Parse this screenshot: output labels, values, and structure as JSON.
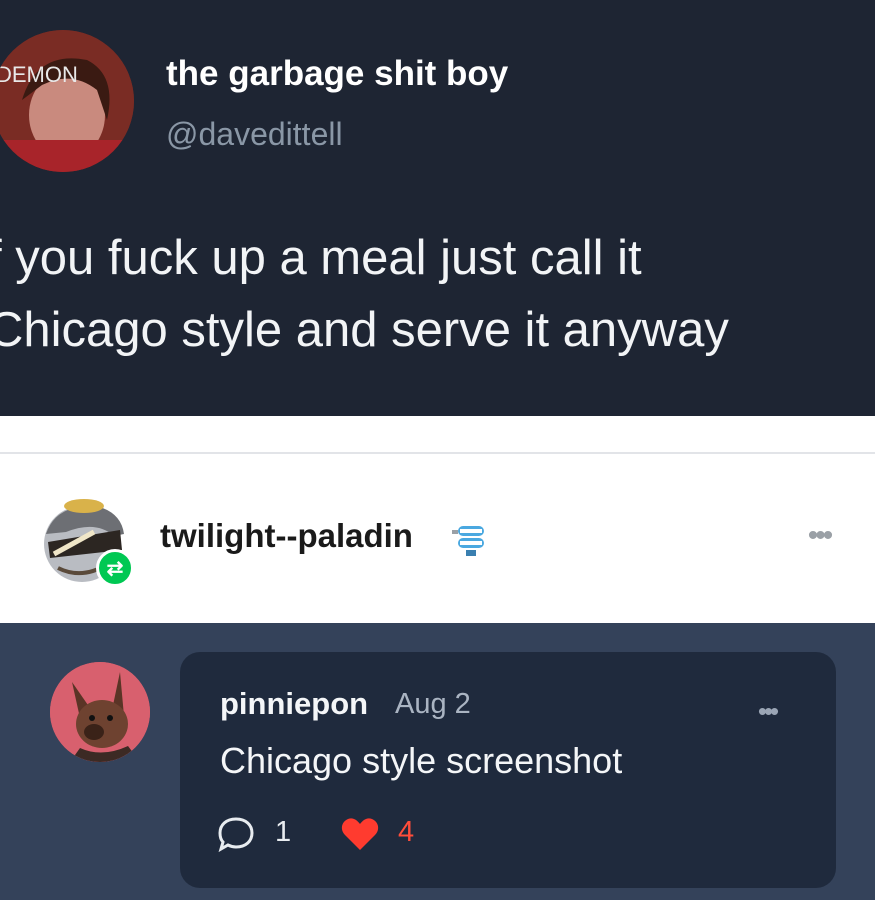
{
  "tweet": {
    "display_name": "the garbage shit boy",
    "handle": "@davedittell",
    "text_lines": [
      "f you fuck up a meal just call it",
      "Chicago style and serve it anyway"
    ],
    "avatar_text": "DEMON",
    "avatar_icon": "profile-photo"
  },
  "post": {
    "blog_name": "twilight--paladin",
    "avatar_icon": "cartoon-avatar",
    "reblog_icon": "reblog-icon",
    "badge_icon": "chattering-teeth-icon",
    "more_label": "•••"
  },
  "note": {
    "username": "pinniepon",
    "date": "Aug 2",
    "text": "Chicago style screenshot",
    "comment_count": "1",
    "like_count": "4",
    "more_label": "•••",
    "colors": {
      "card": "#1f2a3d",
      "section": "#34425a",
      "like": "#ff4d3a"
    }
  }
}
